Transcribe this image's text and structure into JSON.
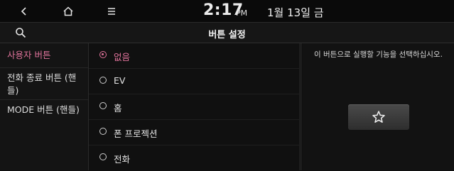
{
  "statusbar": {
    "time": "2:17",
    "ampm": "PM",
    "date": "1월 13일 금",
    "icons": [
      "back-icon",
      "home-icon",
      "menu-icon"
    ]
  },
  "header": {
    "title": "버튼 설정",
    "search_icon": "search-icon"
  },
  "sidebar": {
    "items": [
      {
        "label": "사용자 버튼",
        "active": true
      },
      {
        "label": "전화 종료 버튼 (핸",
        "label_line2": "들)",
        "active": false
      },
      {
        "label": "MODE 버튼 (핸들)",
        "active": false
      }
    ]
  },
  "options": {
    "items": [
      {
        "label": "없음",
        "selected": true
      },
      {
        "label": "EV",
        "selected": false
      },
      {
        "label": "홈",
        "selected": false
      },
      {
        "label": "폰 프로젝션",
        "selected": false
      },
      {
        "label": "전화",
        "selected": false
      }
    ]
  },
  "right_pane": {
    "hint": "이 버튼으로 실행할 기능을 선택하십시오.",
    "button_icon": "star-icon"
  },
  "colors": {
    "accent": "#e0739b",
    "background": "#0f0f0f",
    "text": "#ececec"
  }
}
